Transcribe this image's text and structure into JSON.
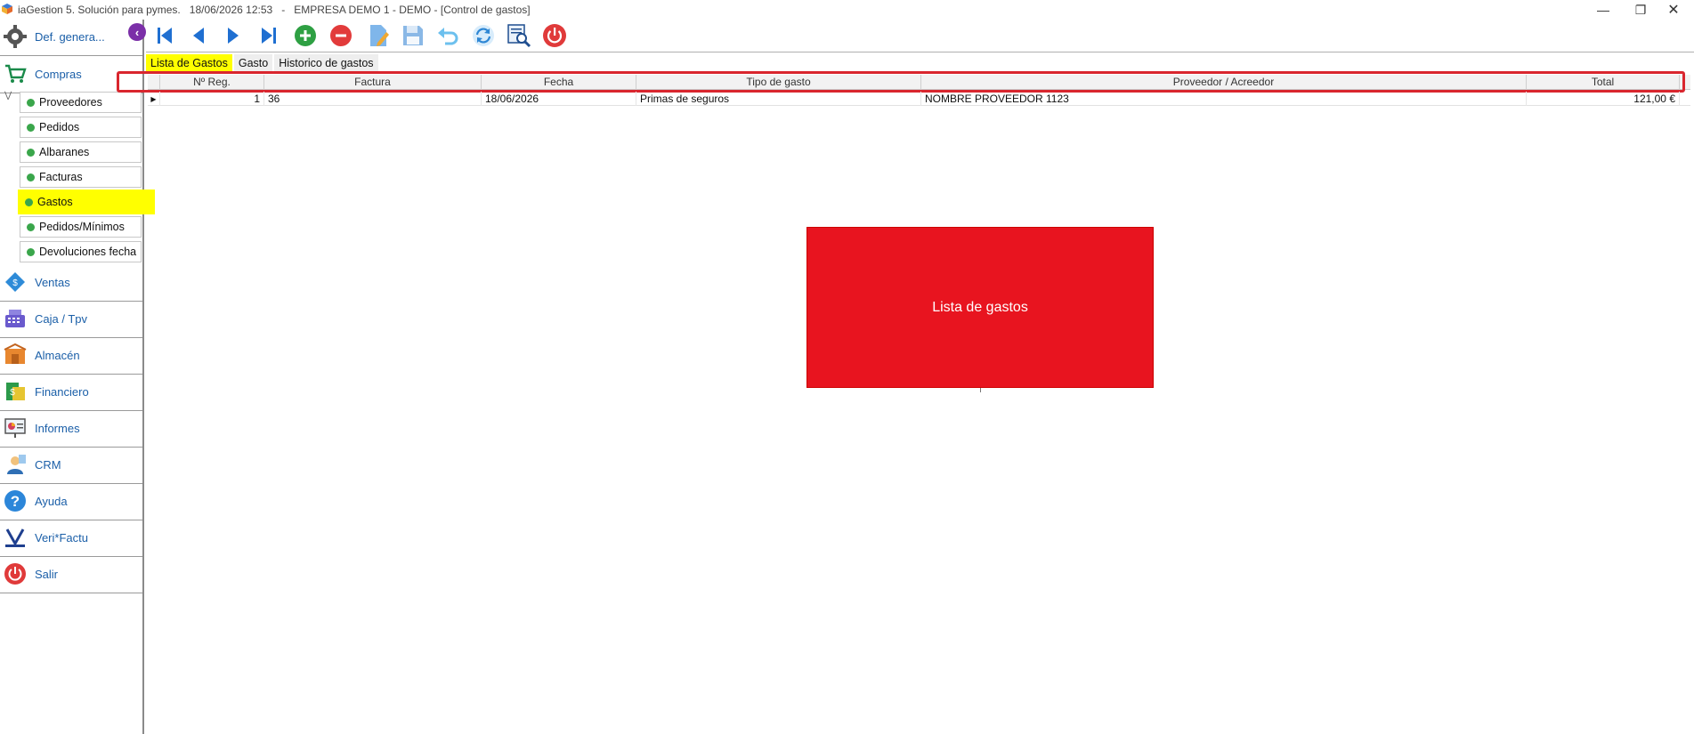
{
  "window": {
    "title": "iaGestion 5. Solución para pymes.   18/06/2026 12:53   -   EMPRESA DEMO 1 - DEMO - [Control de gastos]"
  },
  "sidebar": {
    "sections": [
      {
        "label": "Def. genera..."
      },
      {
        "label": "Compras"
      }
    ],
    "subitems": [
      {
        "label": "Proveedores"
      },
      {
        "label": "Pedidos"
      },
      {
        "label": "Albaranes"
      },
      {
        "label": "Facturas"
      },
      {
        "label": "Gastos"
      },
      {
        "label": "Pedidos/Mínimos"
      },
      {
        "label": "Devoluciones fecha"
      }
    ],
    "modules": [
      {
        "label": "Ventas"
      },
      {
        "label": "Caja / Tpv"
      },
      {
        "label": "Almacén"
      },
      {
        "label": "Financiero"
      },
      {
        "label": "Informes"
      },
      {
        "label": "CRM"
      },
      {
        "label": "Ayuda"
      },
      {
        "label": "Veri*Factu"
      },
      {
        "label": "Salir"
      }
    ],
    "active_subitem": "Gastos",
    "colors": {
      "active": "#ffff00",
      "dot": "#3aa64b",
      "link": "#1b5fa8"
    }
  },
  "toolbar": {
    "buttons": [
      "first-icon",
      "previous-icon",
      "next-icon",
      "last-icon",
      "add-icon",
      "delete-icon",
      "edit-icon",
      "save-icon",
      "undo-icon",
      "refresh-icon",
      "search-icon",
      "close-icon"
    ]
  },
  "tabs": [
    {
      "label": "Lista de Gastos",
      "active": true
    },
    {
      "label": "Gasto",
      "active": false
    },
    {
      "label": "Historico de gastos",
      "active": false
    }
  ],
  "table": {
    "columns": [
      "Nº Reg.",
      "Factura",
      "Fecha",
      "Tipo de gasto",
      "Proveedor / Acreedor",
      "Total"
    ],
    "rows": [
      {
        "reg": "1",
        "factura": "36",
        "fecha": "18/06/2026",
        "tipo": "Primas de seguros",
        "proveedor": "NOMBRE PROVEEDOR 1123",
        "total": "121,00 €"
      }
    ]
  },
  "callout": {
    "text": "Lista de gastos",
    "color": "#e8141f"
  }
}
